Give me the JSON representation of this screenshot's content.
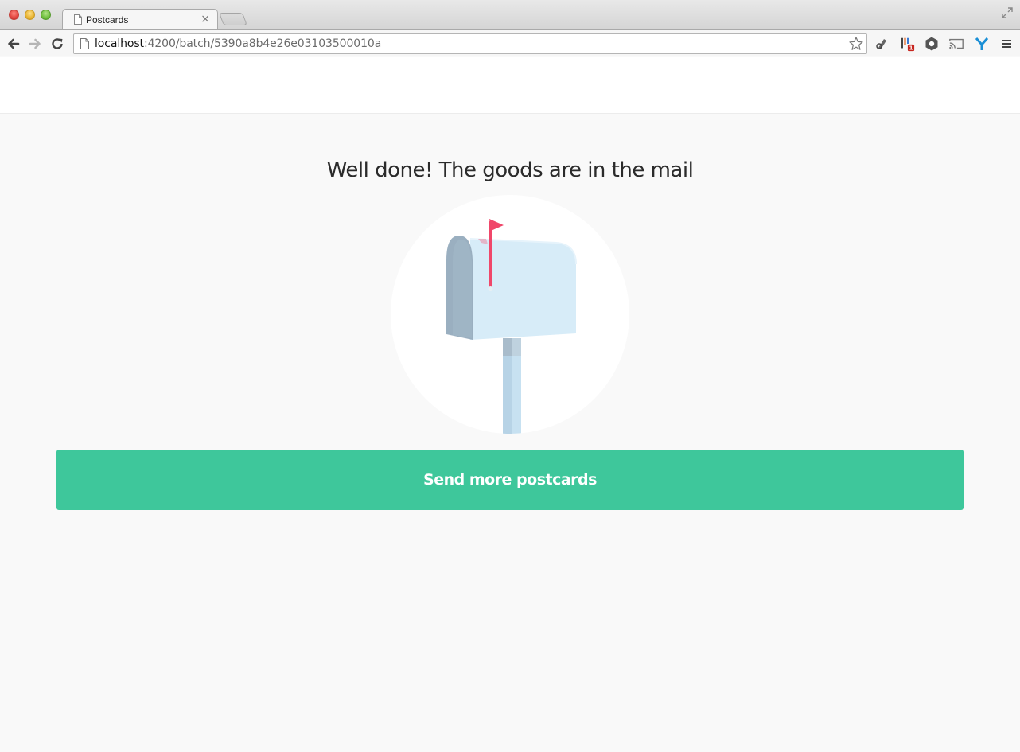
{
  "browser": {
    "tab_title": "Postcards",
    "tab_close": "×",
    "url_host": "localhost",
    "url_rest": ":4200/batch/5390a8b4e26e03103500010a",
    "extension_badge": "1"
  },
  "page": {
    "headline": "Well done! The goods are in the mail",
    "cta_label": "Send more postcards"
  },
  "colors": {
    "accent": "#3ec79b",
    "flag": "#f0476a",
    "mailbox": "#d7ecf8",
    "mailbox_shadow": "#9aafc0"
  },
  "icons": [
    "close-icon",
    "back-arrow-icon",
    "forward-arrow-icon",
    "reload-icon",
    "page-icon",
    "star-icon",
    "mailbox-illustration"
  ]
}
